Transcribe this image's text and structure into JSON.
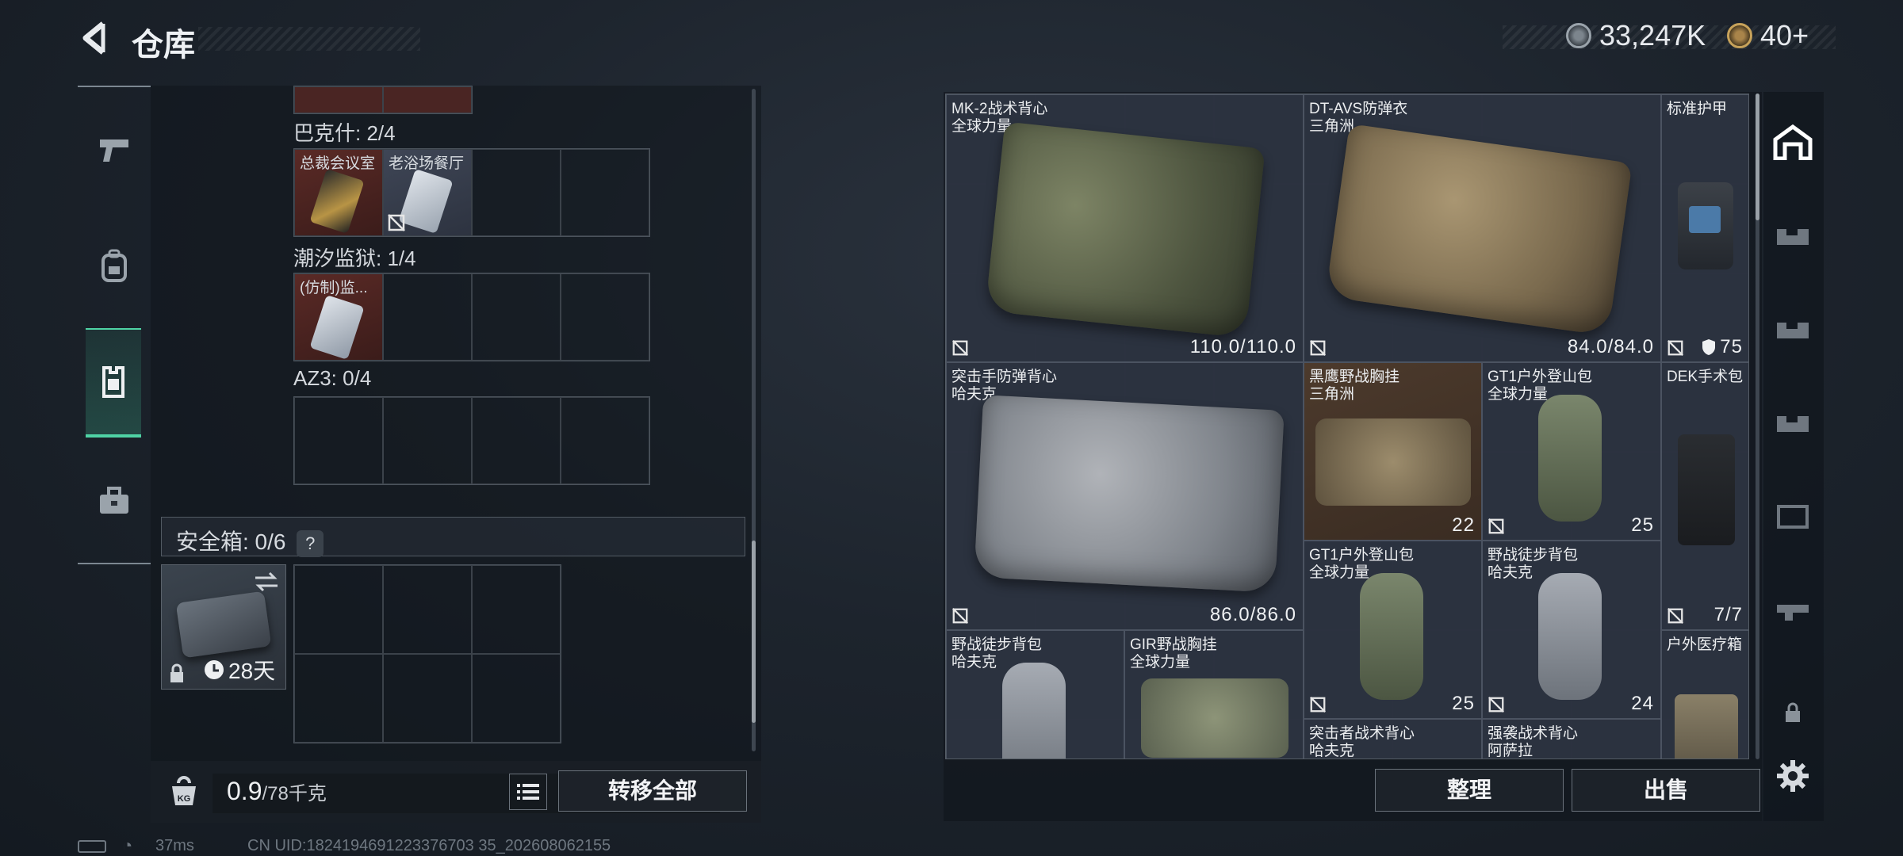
{
  "header": {
    "title": "仓库",
    "currency_1": "33,247K",
    "currency_2": "40+"
  },
  "sidebar": {
    "items": [
      {
        "icon": "pistol-icon"
      },
      {
        "icon": "backpack-icon"
      },
      {
        "icon": "vest-icon",
        "active": true
      },
      {
        "icon": "briefcase-icon"
      }
    ]
  },
  "left": {
    "top_cards_partial": true,
    "sections": [
      {
        "label": "巴克什: 2/4",
        "cards": [
          "总裁会议室",
          "老浴场餐厅"
        ]
      },
      {
        "label": "潮汐监狱: 1/4",
        "cards": [
          "(仿制)监..."
        ]
      },
      {
        "label": "AZ3: 0/4",
        "cards": []
      }
    ],
    "safe_label": "安全箱: 0/6",
    "safe_help": "?",
    "safe_days": "28天",
    "weight_current": "0.9",
    "weight_max": "/78千克",
    "weight_unit_icon": "KG",
    "transfer_all": "转移全部"
  },
  "right": {
    "items": [
      {
        "name": "MK-2战术背心",
        "faction": "全球力量",
        "value": "110.0/110.0"
      },
      {
        "name": "DT-AVS防弹衣",
        "faction": "三角洲",
        "value": "84.0/84.0"
      },
      {
        "name": "标准护甲",
        "faction": "",
        "value": "75"
      },
      {
        "name": "突击手防弹背心",
        "faction": "哈夫克",
        "value": "86.0/86.0"
      },
      {
        "name": "黑鹰野战胸挂",
        "faction": "三角洲",
        "value": "22"
      },
      {
        "name": "GT1户外登山包",
        "faction": "全球力量",
        "value": "25"
      },
      {
        "name": "DEK手术包",
        "faction": "",
        "value": "7/7"
      },
      {
        "name": "GT1户外登山包",
        "faction": "全球力量",
        "value": "25"
      },
      {
        "name": "野战徒步背包",
        "faction": "哈夫克",
        "value": "24"
      },
      {
        "name": "野战徒步背包",
        "faction": "哈夫克",
        "value": ""
      },
      {
        "name": "GIR野战胸挂",
        "faction": "全球力量",
        "value": ""
      },
      {
        "name": "户外医疗箱",
        "faction": "",
        "value": ""
      },
      {
        "name": "突击者战术背心",
        "faction": "哈夫克",
        "value": ""
      },
      {
        "name": "强袭战术背心",
        "faction": "阿萨拉",
        "value": ""
      }
    ],
    "sort_button": "整理",
    "sell_button": "出售"
  },
  "footer": {
    "ping": "37ms",
    "uid": "CN UID:1824194691223376703 35_202608062155"
  },
  "colors": {
    "accent": "#4fd3a5",
    "panel": "#2b3140",
    "card_red": "#5a2a26"
  }
}
